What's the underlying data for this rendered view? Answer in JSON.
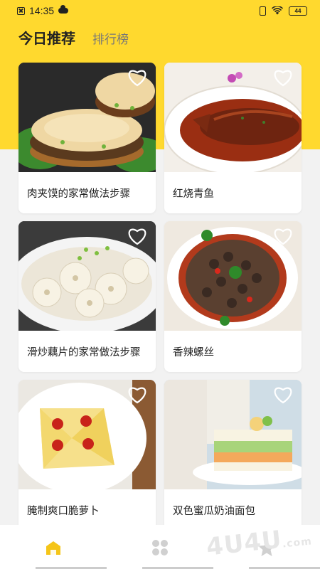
{
  "status_bar": {
    "time": "14:35",
    "battery": "44"
  },
  "header": {
    "tabs": [
      {
        "label": "今日推荐",
        "active": true
      },
      {
        "label": "排行榜",
        "active": false
      }
    ]
  },
  "recipes": [
    {
      "title": "肉夹馍的家常做法步骤",
      "favorited": false
    },
    {
      "title": "红烧青鱼",
      "favorited": false
    },
    {
      "title": "滑炒藕片的家常做法步骤",
      "favorited": false
    },
    {
      "title": "香辣螺丝",
      "favorited": false
    },
    {
      "title": "腌制爽口脆萝卜",
      "favorited": false
    },
    {
      "title": "双色蜜瓜奶油面包",
      "favorited": false
    }
  ],
  "bottom_nav": {
    "items": [
      "home-icon",
      "category-icon",
      "star-icon"
    ],
    "active_index": 0
  },
  "watermark": {
    "text": "4U4U",
    "suffix": ".com"
  },
  "colors": {
    "accent": "#ffd92e",
    "nav_active": "#f5c518",
    "nav_inactive": "#d0d0d0"
  }
}
